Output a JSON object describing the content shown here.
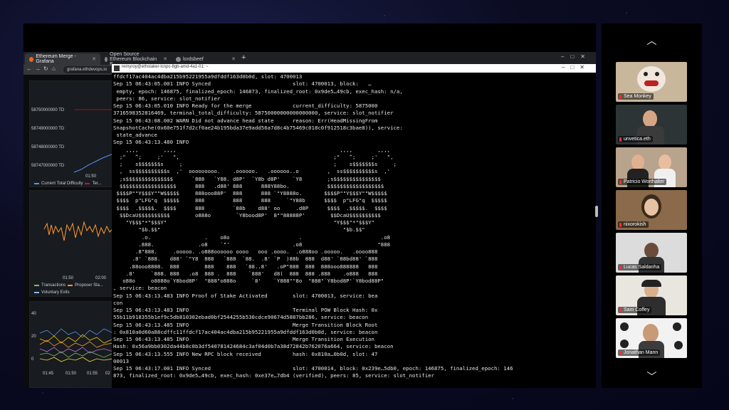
{
  "browser": {
    "tabs": [
      {
        "label": "Ethereum Merge - Grafana"
      },
      {
        "label": "Open Source Ethereum Blockchain E..."
      },
      {
        "label": "lordsbeef"
      }
    ],
    "url": "grafana.ethdevops.io"
  },
  "grafana": {
    "panel1": {
      "y_ticks": [
        "58750000000 TD",
        "58749000000 TD",
        "58748000000 TD",
        "58747000000 TD"
      ],
      "x_tick": "01:50",
      "legend": [
        "Current Total Difficulty",
        "Ter..."
      ]
    },
    "panel2": {
      "x_ticks": [
        "01:50",
        "02:00"
      ],
      "legend": [
        "Transactions",
        "Proposer Sla...",
        "Voluntary Exits"
      ]
    },
    "panel3": {
      "y_ticks": [
        "40",
        "20",
        "0"
      ],
      "x_ticks": [
        "01:45",
        "01:50",
        "01:55",
        "02"
      ]
    }
  },
  "terminal": {
    "title": "remyroy@ethstaker-lcnpc-8gb-amd-4a1-01: ~",
    "text": "ffdcf17ac404ac4dba215b95221955a9dfddf163d0b0d, slot: 4700013\nSep 15 06:43:05.001 INFO Synced                          slot: 4700013, block:   …\n empty, epoch: 146875, finalized_epoch: 146873, finalized_root: 0x9de5…49cb, exec_hash: n/a,\n peers: 86, service: slot_notifier\nSep 15 06:43:05.010 INFO Ready for the merge             current_difficulty: 5875000\n3716598352816469, terminal_total_difficulty: 58750000000000000000, service: slot_notifier\nSep 15 06:43:08.002 WARN Did not advance head state      reason: Err(HeadMissingFrom\nSnapshotCache(0x60e751f7d2cf0ae24b195bda37e9add56a7d8c4b75469c018c0f912518c3bae8)), service:\n state_advance\nSep 15 06:43:13.480 INFO\n    ,,,,        ,,,,                                                    ,,,,        ,,,,\n  ;\"   ^;     ;'   \",                                                 ;\"   ^;     ;'   \",\n  ;    s$$$$$$$s     ;                                                ;    s$$$$$$$s     ;\n  ,  ss$$$$$$$$$$s  ,'  ooooooooo.    .oooooo.   .oooooo..o         ,  ss$$$$$$$$$$s  ,'\n  ;s$$$$$$$$$$$$$$$      `888   `Y88. d8P'  `Y8b d8P'    `Y8        ;s$$$$$$$$$$$$$$$\n  $$$$$$$$$$$$$$$$$$      888   .d88' 888      888Y88bo.            $$$$$$$$$$$$$$$$$$\n $$$$P\"\"Y$$$Y\"\"W$$$$$     888ooo88P'  888      888 `\"Y8888o.       $$$$P\"\"Y$$$Y\"\"W$$$$$\n $$$$  p\"LFG\"q  $$$$$     888         888      888     `\"Y88b      $$$$  p\"LFG\"q  $$$$$\n $$$$  .$$$$$.  $$$$      888         `88b    d88' oo     .d8P      $$$$  .$$$$$.  $$$$\n  $$DcaU$$$$$$$$$$        o888o        `Y8bood8P'  8\"\"88888P'        $$DcaU$$$$$$$$$$\n    \"Y$$$\"*\"$$$Y\"                                                     \"Y$$$\"*\"$$$Y\"\n        \"$b.$$\"                                                          \"$b.$$\"\n         .o.                 .    o8o                      .                         .o8\n        .888.              .o8    `\"'                    .o8                        \"888\n       .8\"888.     .ooooo. .o888oooooo oooo   ooo .oooo.  .o888oo .ooooo.   .oooo888\n      .8' `888.   d88' `\"Y8  888   `888  `88.  .8' `P  )88b  888  d88' `88bd88' `888\n     .88ooo8888.  888        888    888   `88..8'   .oP\"888  888  888ooo888888   888\n    .8'     `888. 888   .o8  888 .  888    `888'   d8(  888  888 .888    .o888   888\n   o88o     o8888o`Y8bod8P'  \"888\"o888o     `8'    `Y888\"\"8o  \"888\"`Y8bod8P'`Y8bod88P\"\n, service: beacon\nSep 15 06:43:13.483 INFO Proof of Stake Activated        slot: 4700013, service: bea\ncon\nSep 15 06:43:13.483 INFO                                 Terminal POW Block Hash: 0x\n55b11b918355b1ef9c5db810302ebad0bf2544255b530cdce90674d5887bb286, service: beacon\nSep 15 06:43:13.485 INFO                                 Merge Transition Block Root\n: 0x810a0d60a88cdffc11ffdcf17ac404ac4dba215b95221955a9dfddf163d0b0d, service: beacon\nSep 15 06:43:13.485 INFO                                 Merge Transition Execution\nHash: 0x56a9bb0302da44b8c0b3df540781424684c3af04d0b7a38d72842b762076a664, service: beacon\nSep 15 06:43:13.555 INFO New RPC block received          hash: 0x810a…0b0d, slot: 47\n00013\nSep 15 06:43:17.001 INFO Synced                          slot: 4700014, block: 0x239e…5db0, epoch: 146875, finalized_epoch: 146\n873, finalized_root: 0x9de5…49cb, exec_hash: 0xe37e…7db4 (verified), peers: 85, service: slot_notifier"
  },
  "participants": [
    {
      "name": "Sea Monkey"
    },
    {
      "name": "unvetica.eth"
    },
    {
      "name": "Patricio Worthalter"
    },
    {
      "name": "nixorokish"
    },
    {
      "name": "Lucas Saldanha"
    },
    {
      "name": "Sam Coffey"
    },
    {
      "name": "Jonathan Mann"
    }
  ],
  "colors": {
    "grafana_blue": "#5794f2",
    "grafana_orange": "#ff9830",
    "mic_muted": "#e33333"
  },
  "icons": [
    "chevron-up-icon",
    "chevron-down-icon",
    "mic-muted-icon",
    "back-icon",
    "forward-icon",
    "reload-icon",
    "home-icon"
  ]
}
